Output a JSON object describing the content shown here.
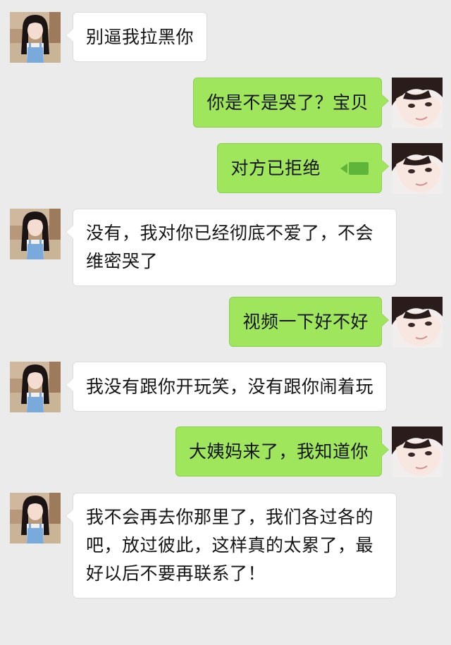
{
  "messages": [
    {
      "side": "left",
      "text": "别逼我拉黑你"
    },
    {
      "side": "right",
      "text": "你是不是哭了？宝贝"
    },
    {
      "side": "right",
      "text": "对方已拒绝",
      "icon": "video-call-icon"
    },
    {
      "side": "left",
      "text": "没有，我对你已经彻底不爱了，不会\n维密哭了"
    },
    {
      "side": "right",
      "text": "视频一下好不好"
    },
    {
      "side": "left",
      "text": "我没有跟你开玩笑，没有跟你闹着玩"
    },
    {
      "side": "right",
      "text": "大姨妈来了，我知道你"
    },
    {
      "side": "left",
      "text": "我不会再去你那里了，我们各过各的\n吧，放过彼此，这样真的太累了，最\n好以后不要再联系了！"
    }
  ],
  "colors": {
    "background": "#ebebeb",
    "sent_bubble": "#9fe65c",
    "received_bubble": "#ffffff"
  }
}
